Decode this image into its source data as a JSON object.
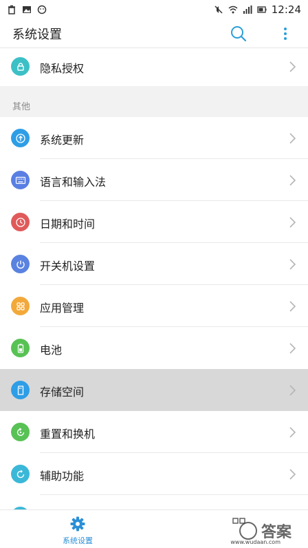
{
  "status_bar": {
    "time": "12:24",
    "left_icons": [
      "trash-icon",
      "image-icon",
      "smiley-icon"
    ],
    "right_icons": [
      "mute-icon",
      "wifi-icon",
      "signal-icon",
      "battery-icon"
    ]
  },
  "app_bar": {
    "title": "系统设置",
    "actions": [
      "search-icon",
      "more-vert-icon"
    ]
  },
  "top_item": {
    "label": "隐私授权",
    "icon": "lock-icon",
    "color": "#3cc0c6"
  },
  "section": {
    "label": "其他"
  },
  "items": [
    {
      "label": "系统更新",
      "icon": "upload-icon",
      "color": "#2e9ee6"
    },
    {
      "label": "语言和输入法",
      "icon": "keyboard-icon",
      "color": "#5a7fe3"
    },
    {
      "label": "日期和时间",
      "icon": "clock-icon",
      "color": "#e05a5a"
    },
    {
      "label": "开关机设置",
      "icon": "power-icon",
      "color": "#5a82e0"
    },
    {
      "label": "应用管理",
      "icon": "apps-icon",
      "color": "#f2a93a"
    },
    {
      "label": "电池",
      "icon": "battery-icon",
      "color": "#58c255"
    },
    {
      "label": "存储空间",
      "icon": "storage-icon",
      "color": "#2e9ee6",
      "pressed": true
    },
    {
      "label": "重置和换机",
      "icon": "reset-icon",
      "color": "#58c255"
    },
    {
      "label": "辅助功能",
      "icon": "accessibility-icon",
      "color": "#3bb8d8"
    }
  ],
  "bottom_nav": {
    "items": [
      {
        "label": "系统设置",
        "icon": "gear-icon",
        "active": true
      }
    ]
  },
  "watermark": {
    "text": "答案",
    "url": "www.wudaan.com"
  },
  "colors": {
    "accent": "#2b8fd6",
    "section_bg": "#f2f2f2",
    "pressed_bg": "#d8d8d8"
  }
}
